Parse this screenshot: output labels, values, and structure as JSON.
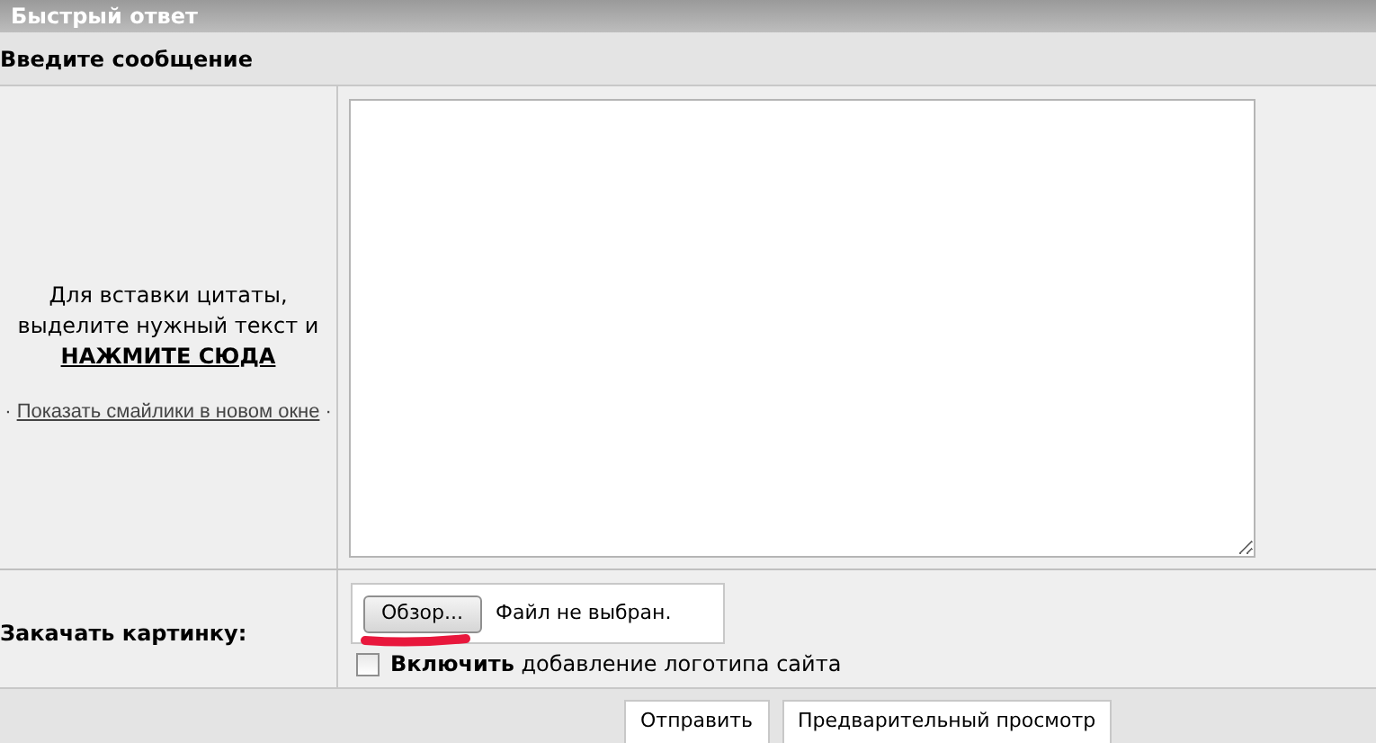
{
  "header": {
    "title": "Быстрый ответ"
  },
  "section": {
    "title": "Введите сообщение"
  },
  "sidebar": {
    "hint": "Для вставки цитаты, выделите нужный текст и",
    "quote_link": "НАЖМИТЕ СЮДА",
    "bullet_left": "·",
    "smilies_link": "Показать смайлики в новом окне",
    "bullet_right": "·"
  },
  "upload": {
    "label": "Закачать картинку:",
    "browse_button": "Обзор...",
    "file_status": "Файл не выбран.",
    "logo_option": {
      "label": "**Включить** добавление логотипа сайта",
      "checked": false
    }
  },
  "buttons": [
    {
      "label": "Отправить"
    },
    {
      "label": "Предварительный просмотр"
    }
  ]
}
